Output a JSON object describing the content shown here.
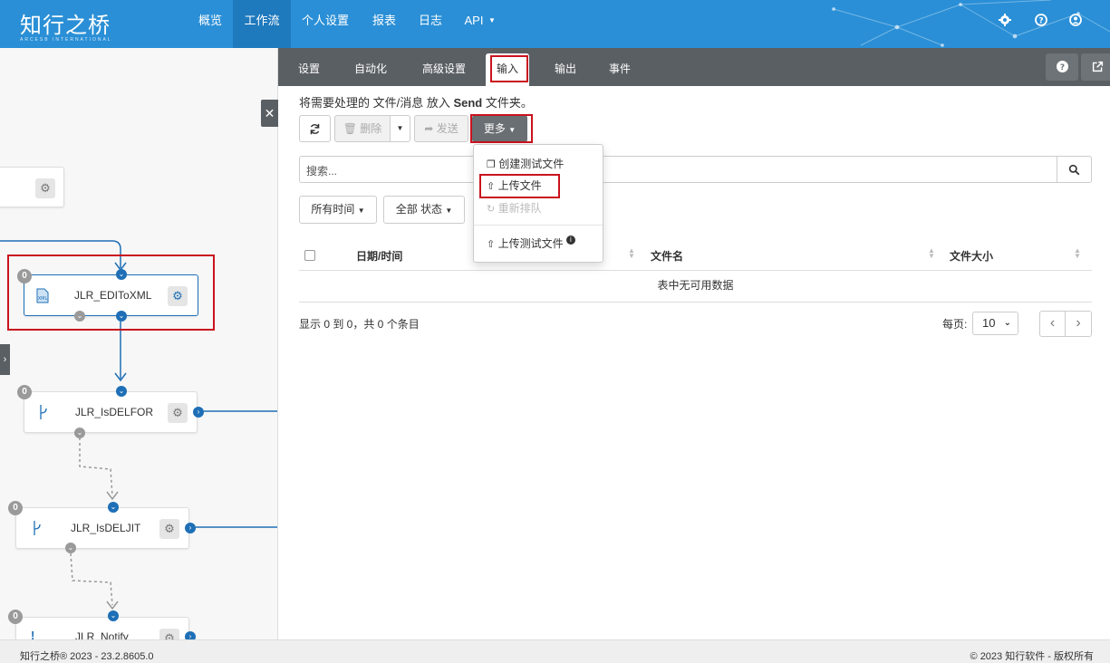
{
  "header": {
    "logo_text": "知行之桥",
    "logo_sub": "ARCESB INTERNATIONAL",
    "nav": [
      "概览",
      "工作流",
      "个人设置",
      "报表",
      "日志",
      "API"
    ],
    "active_nav": "工作流"
  },
  "workflow": {
    "nodes": [
      {
        "name": "JLR_EDIToXML",
        "count": "0"
      },
      {
        "name": "JLR_IsDELFOR",
        "count": "0"
      },
      {
        "name": "JLR_IsDELJIT",
        "count": "0"
      },
      {
        "name": "JLR_Notify",
        "count": "0"
      }
    ]
  },
  "tabs": [
    "设置",
    "自动化",
    "高级设置",
    "输入",
    "输出",
    "事件"
  ],
  "active_tab": "输入",
  "description": {
    "prefix": "将需要处理的 文件/消息 放入",
    "folder": "Send",
    "suffix": "文件夹。"
  },
  "toolbar": {
    "delete": "删除",
    "send": "发送",
    "more": "更多"
  },
  "more_menu": {
    "create_test": "创建测试文件",
    "upload": "上传文件",
    "requeue": "重新排队",
    "upload_test": "上传测试文件"
  },
  "search": {
    "placeholder": "搜索..."
  },
  "filters": {
    "time": "所有时间",
    "status": "全部 状态"
  },
  "table": {
    "columns": [
      "日期/时间",
      "文件名",
      "文件大小"
    ],
    "empty": "表中无可用数据"
  },
  "pagination": {
    "info": "显示 0 到 0，共 0 个条目",
    "per_page_label": "每页:",
    "per_page": "10"
  },
  "footer": {
    "left": "知行之桥® 2023 - 23.2.8605.0",
    "right": "© 2023 知行软件 - 版权所有"
  }
}
